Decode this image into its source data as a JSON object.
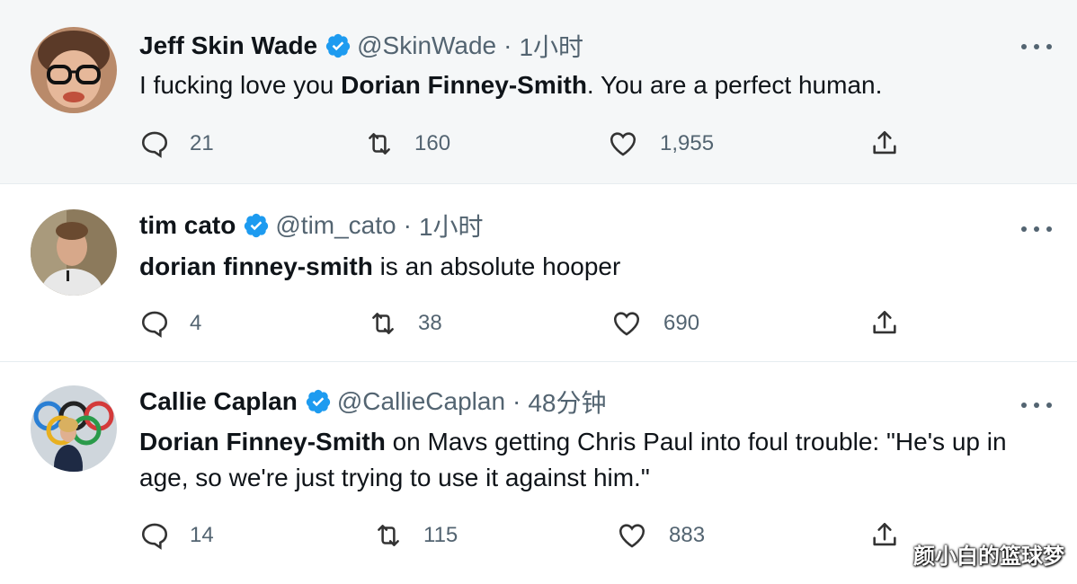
{
  "tweets": [
    {
      "name": "Jeff Skin Wade",
      "handle": "@SkinWade",
      "separator": "·",
      "time": "1小时",
      "text_bold": "Dorian Finney-Smith",
      "text_pre": "I fucking love you ",
      "text_post": ". You are a perfect human.",
      "replies": "21",
      "retweets": "160",
      "likes": "1,955"
    },
    {
      "name": "tim cato",
      "handle": "@tim_cato",
      "separator": "·",
      "time": "1小时",
      "text_pre": "",
      "text_bold": "dorian finney-smith",
      "text_post": " is an absolute hooper",
      "replies": "4",
      "retweets": "38",
      "likes": "690"
    },
    {
      "name": "Callie Caplan",
      "handle": "@CallieCaplan",
      "separator": "·",
      "time": "48分钟",
      "text_pre": "",
      "text_bold": "Dorian Finney-Smith",
      "text_post": " on Mavs getting Chris Paul into foul trouble: \"He's up in age, so we're just trying to use it against him.\"",
      "replies": "14",
      "retweets": "115",
      "likes": "883"
    }
  ],
  "icons": {
    "reply": "reply-icon",
    "retweet": "retweet-icon",
    "like": "heart-icon",
    "share": "share-icon",
    "verified": "verified-badge-icon",
    "more": "more-options-icon"
  },
  "colors": {
    "verified": "#1d9bf0",
    "muted": "#536471",
    "text": "#0f1419"
  },
  "watermark": "颜小白的篮球梦"
}
